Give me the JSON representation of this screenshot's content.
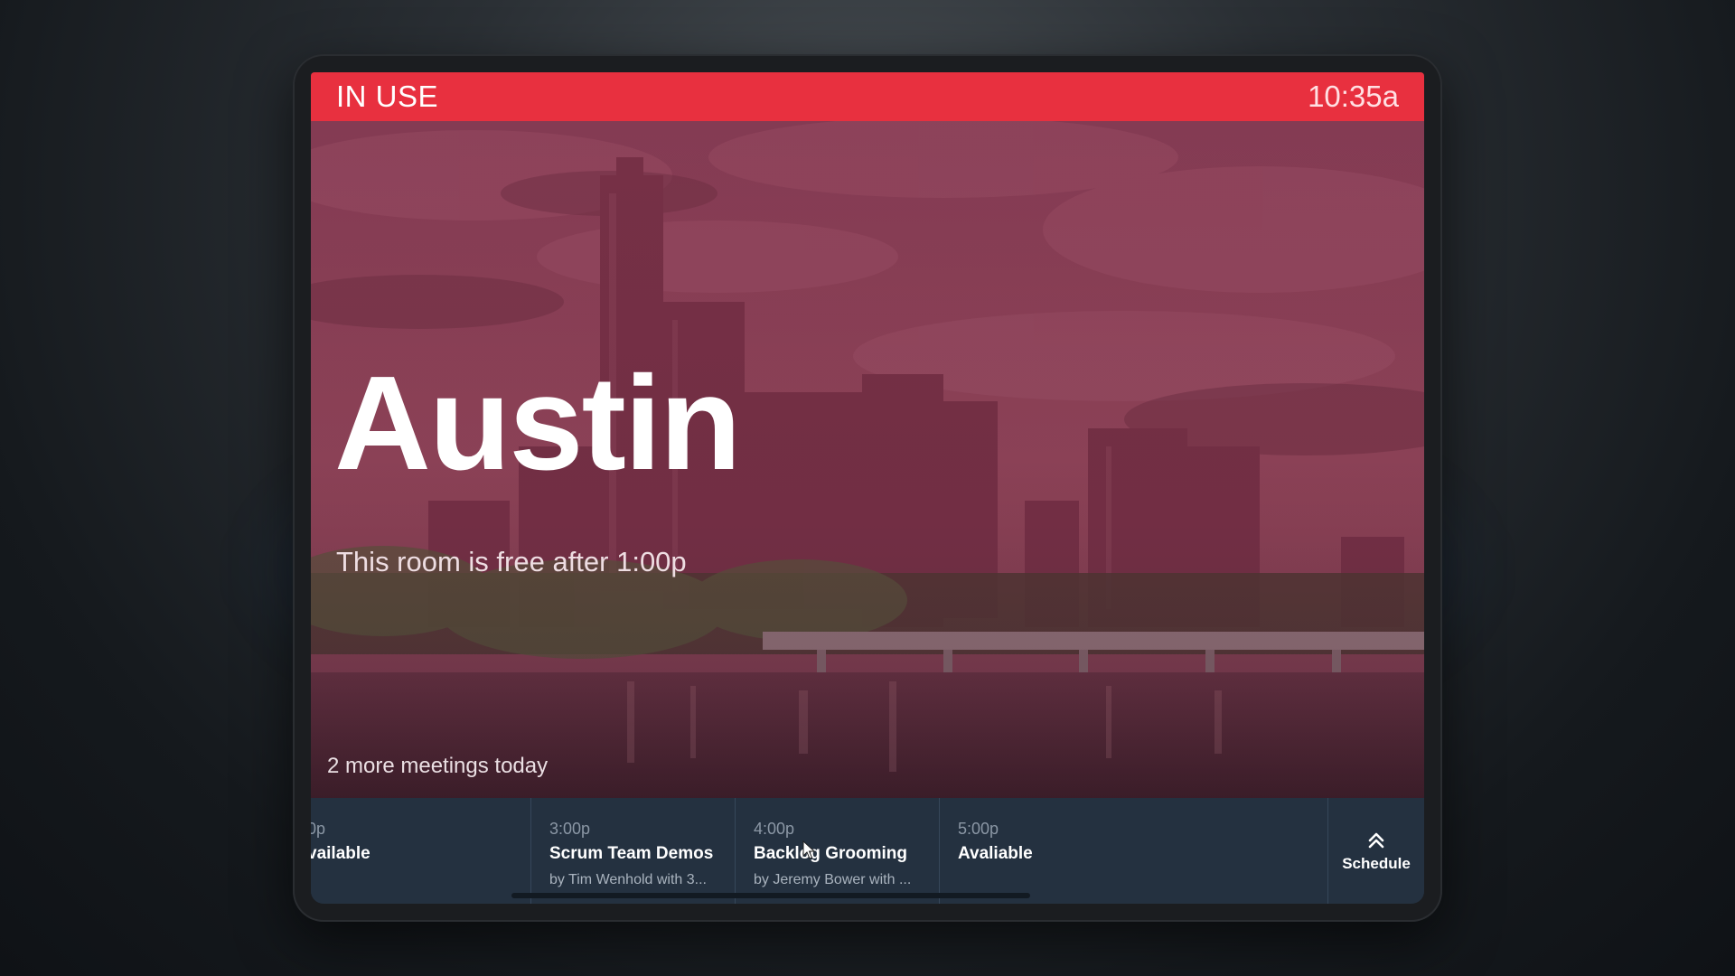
{
  "status": {
    "label": "IN USE",
    "time": "10:35a",
    "color": "#e8303f"
  },
  "room": {
    "name": "Austin",
    "availability": "This room is free after 1:00p",
    "more_meetings": "2 more meetings today"
  },
  "schedule": {
    "slots": [
      {
        "time": "0p",
        "title": "vailable",
        "host": ""
      },
      {
        "time": "3:00p",
        "title": "Scrum Team Demos",
        "host": "by Tim Wenhold with 3..."
      },
      {
        "time": "4:00p",
        "title": "Backlog Grooming",
        "host": "by Jeremy Bower with ..."
      },
      {
        "time": "5:00p",
        "title": "Avaliable",
        "host": ""
      }
    ],
    "button_label": "Schedule",
    "button_icon": "double-chevron-up-icon"
  },
  "colors": {
    "status_bar": "#e8303f",
    "strip_background": "#243140",
    "tint": "#96284680"
  }
}
